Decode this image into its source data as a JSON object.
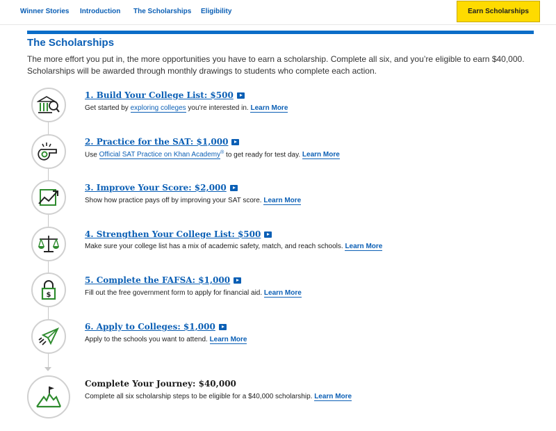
{
  "nav": {
    "links": [
      "Winner Stories",
      "Introduction",
      "The Scholarships",
      "Eligibility"
    ],
    "cta": "Earn Scholarships"
  },
  "section": {
    "heading": "The Scholarships",
    "intro": "The more effort you put in, the more opportunities you have to earn a scholarship. Complete all six, and you’re eligible to earn $40,000. Scholarships will be awarded through monthly drawings to students who complete each action."
  },
  "steps": [
    {
      "icon": "building-search-icon",
      "title": "1. Build Your College List: $500",
      "desc_pre": "Get started by ",
      "desc_link": "exploring colleges",
      "desc_post": " you’re interested in. ",
      "learn_more": "Learn More"
    },
    {
      "icon": "whistle-icon",
      "title": "2. Practice for the SAT: $1,000",
      "desc_pre": "Use ",
      "desc_link": "Official SAT Practice on Khan Academy",
      "desc_sup": "®",
      "desc_post": " to get ready for test day. ",
      "learn_more": "Learn More"
    },
    {
      "icon": "trend-chart-icon",
      "title": "3. Improve Your Score: $2,000",
      "desc": "Show how practice pays off by improving your SAT score. ",
      "learn_more": "Learn More"
    },
    {
      "icon": "balance-scale-icon",
      "title": "4. Strengthen Your College List: $500",
      "desc": "Make sure your college list has a mix of academic safety, match, and reach schools. ",
      "learn_more": "Learn More"
    },
    {
      "icon": "dollar-lock-icon",
      "title": "5. Complete the FAFSA: $1,000",
      "desc": "Fill out the free government form to apply for financial aid. ",
      "learn_more": "Learn More"
    },
    {
      "icon": "paper-plane-icon",
      "title": "6. Apply to Colleges: $1,000",
      "desc": "Apply to the schools you want to attend. ",
      "learn_more": "Learn More"
    }
  ],
  "final": {
    "icon": "mountain-flag-icon",
    "title": "Complete Your Journey: $40,000",
    "desc": "Complete all six scholarship steps to be eligible for a $40,000 scholarship. ",
    "learn_more": "Learn More"
  },
  "colors": {
    "link": "#0b5fb5",
    "accent_green": "#2e8b2e",
    "cta_bg": "#fedb00",
    "rule": "#0b6dc8"
  }
}
